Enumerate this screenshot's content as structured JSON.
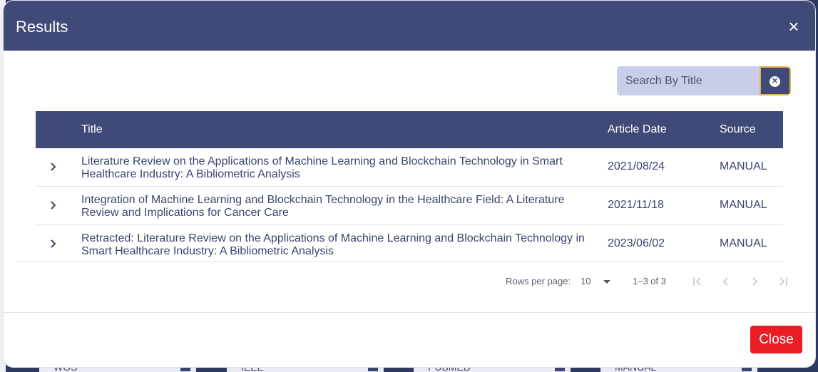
{
  "modal": {
    "title": "Results",
    "close_icon": "close-icon",
    "close_button_label": "Close"
  },
  "search": {
    "placeholder": "Search By Title",
    "value": "",
    "clear_icon": "clear-circle-icon"
  },
  "table": {
    "headers": {
      "title": "Title",
      "article_date": "Article Date",
      "source": "Source"
    },
    "rows": [
      {
        "title": "Literature Review on the Applications of Machine Learning and Blockchain Technology in Smart Healthcare Industry: A Bibliometric Analysis",
        "date": "2021/08/24",
        "source": "MANUAL"
      },
      {
        "title": "Integration of Machine Learning and Blockchain Technology in the Healthcare Field: A Literature Review and Implications for Cancer Care",
        "date": "2021/11/18",
        "source": "MANUAL"
      },
      {
        "title": "Retracted: Literature Review on the Applications of Machine Learning and Blockchain Technology in Smart Healthcare Industry: A Bibliometric Analysis",
        "date": "2023/06/02",
        "source": "MANUAL"
      }
    ]
  },
  "pagination": {
    "rows_per_page_label": "Rows per page:",
    "rows_per_page_value": "10",
    "range_text": "1–3 of 3"
  },
  "background_chips": [
    {
      "label": "WOS"
    },
    {
      "label": "IEEE"
    },
    {
      "label": "PUBMED"
    },
    {
      "label": "MANUAL"
    }
  ],
  "colors": {
    "header": "#3f4a78",
    "accent_close": "#ea1c24",
    "search_bg": "#c8cdea"
  }
}
